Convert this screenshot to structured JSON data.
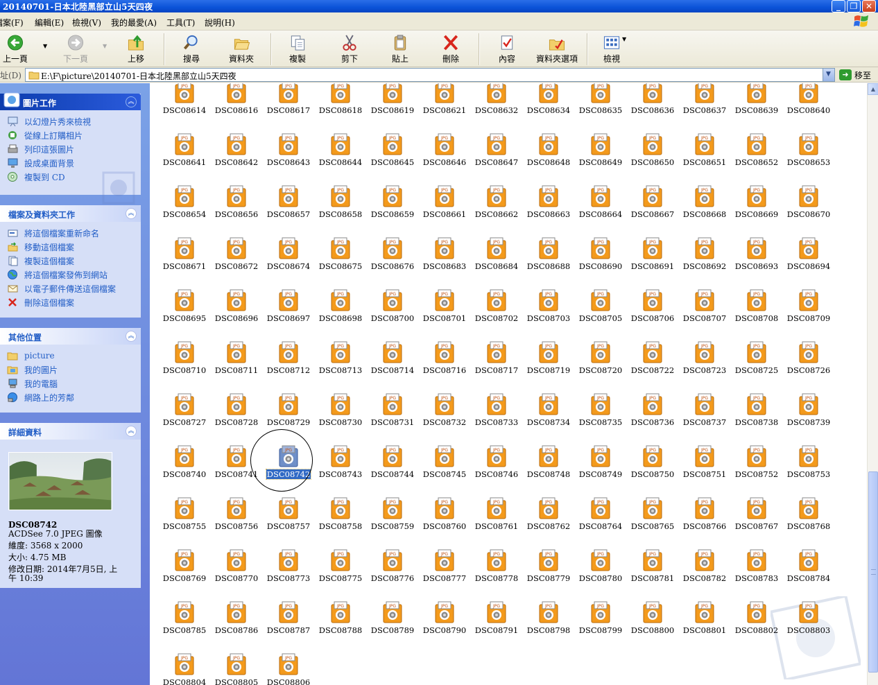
{
  "window": {
    "title": "20140701-日本北陸黑部立山5天四夜"
  },
  "menubar": [
    "檔案(F)",
    "編輯(E)",
    "檢視(V)",
    "我的最愛(A)",
    "工具(T)",
    "說明(H)"
  ],
  "toolbar": {
    "back": "上一頁",
    "forward": "下一頁",
    "up": "上移",
    "search": "搜尋",
    "folders": "資料夾",
    "copy": "複製",
    "cut": "剪下",
    "paste": "貼上",
    "delete": "刪除",
    "properties": "內容",
    "folder_options": "資料夾選項",
    "views": "檢視"
  },
  "address": {
    "label": "址(D)",
    "path": "E:\\F\\picture\\20140701-日本北陸黑部立山5天四夜",
    "go": "移至"
  },
  "panels": {
    "picture_tasks": {
      "title": "圖片工作",
      "items": [
        "以幻燈片秀來檢視",
        "從線上訂購相片",
        "列印這張圖片",
        "設成桌面背景",
        "複製到 CD"
      ]
    },
    "file_tasks": {
      "title": "檔案及資料夾工作",
      "items": [
        "將這個檔案重新命名",
        "移動這個檔案",
        "複製這個檔案",
        "將這個檔案發佈到網站",
        "以電子郵件傳送這個檔案",
        "刪除這個檔案"
      ]
    },
    "other_places": {
      "title": "其他位置",
      "items": [
        "picture",
        "我的圖片",
        "我的電腦",
        "網路上的芳鄰"
      ]
    },
    "details": {
      "title": "詳細資料",
      "filename": "DSC08742",
      "type": "ACDSee 7.0 JPEG 圖像",
      "dimensions": "維度: 3568 x 2000",
      "size": "大小: 4.75 MB",
      "modified": "修改日期: 2014年7月5日, 上午 10:39"
    }
  },
  "icon_badge": "JPG",
  "selected_file": "DSC08742",
  "files": [
    "DSC08614",
    "DSC08616",
    "DSC08617",
    "DSC08618",
    "DSC08619",
    "DSC08621",
    "DSC08632",
    "DSC08634",
    "DSC08635",
    "DSC08636",
    "DSC08637",
    "DSC08639",
    "DSC08640",
    "DSC08641",
    "DSC08642",
    "DSC08643",
    "DSC08644",
    "DSC08645",
    "DSC08646",
    "DSC08647",
    "DSC08648",
    "DSC08649",
    "DSC08650",
    "DSC08651",
    "DSC08652",
    "DSC08653",
    "DSC08654",
    "DSC08656",
    "DSC08657",
    "DSC08658",
    "DSC08659",
    "DSC08661",
    "DSC08662",
    "DSC08663",
    "DSC08664",
    "DSC08667",
    "DSC08668",
    "DSC08669",
    "DSC08670",
    "DSC08671",
    "DSC08672",
    "DSC08674",
    "DSC08675",
    "DSC08676",
    "DSC08683",
    "DSC08684",
    "DSC08688",
    "DSC08690",
    "DSC08691",
    "DSC08692",
    "DSC08693",
    "DSC08694",
    "DSC08695",
    "DSC08696",
    "DSC08697",
    "DSC08698",
    "DSC08700",
    "DSC08701",
    "DSC08702",
    "DSC08703",
    "DSC08705",
    "DSC08706",
    "DSC08707",
    "DSC08708",
    "DSC08709",
    "DSC08710",
    "DSC08711",
    "DSC08712",
    "DSC08713",
    "DSC08714",
    "DSC08716",
    "DSC08717",
    "DSC08719",
    "DSC08720",
    "DSC08722",
    "DSC08723",
    "DSC08725",
    "DSC08726",
    "DSC08727",
    "DSC08728",
    "DSC08729",
    "DSC08730",
    "DSC08731",
    "DSC08732",
    "DSC08733",
    "DSC08734",
    "DSC08735",
    "DSC08736",
    "DSC08737",
    "DSC08738",
    "DSC08739",
    "DSC08740",
    "DSC08741",
    "DSC08742",
    "DSC08743",
    "DSC08744",
    "DSC08745",
    "DSC08746",
    "DSC08748",
    "DSC08749",
    "DSC08750",
    "DSC08751",
    "DSC08752",
    "DSC08753",
    "DSC08755",
    "DSC08756",
    "DSC08757",
    "DSC08758",
    "DSC08759",
    "DSC08760",
    "DSC08761",
    "DSC08762",
    "DSC08764",
    "DSC08765",
    "DSC08766",
    "DSC08767",
    "DSC08768",
    "DSC08769",
    "DSC08770",
    "DSC08773",
    "DSC08775",
    "DSC08776",
    "DSC08777",
    "DSC08778",
    "DSC08779",
    "DSC08780",
    "DSC08781",
    "DSC08782",
    "DSC08783",
    "DSC08784",
    "DSC08785",
    "DSC08786",
    "DSC08787",
    "DSC08788",
    "DSC08789",
    "DSC08790",
    "DSC08791",
    "DSC08798",
    "DSC08799",
    "DSC08800",
    "DSC08801",
    "DSC08802",
    "DSC08803",
    "DSC08804",
    "DSC08805",
    "DSC08806"
  ],
  "colors": {
    "titlebar": "#0a52d8",
    "taskpane": "#6375d6",
    "link": "#215dc6",
    "selection": "#316ac5",
    "icon_orange": "#f39a1c"
  }
}
